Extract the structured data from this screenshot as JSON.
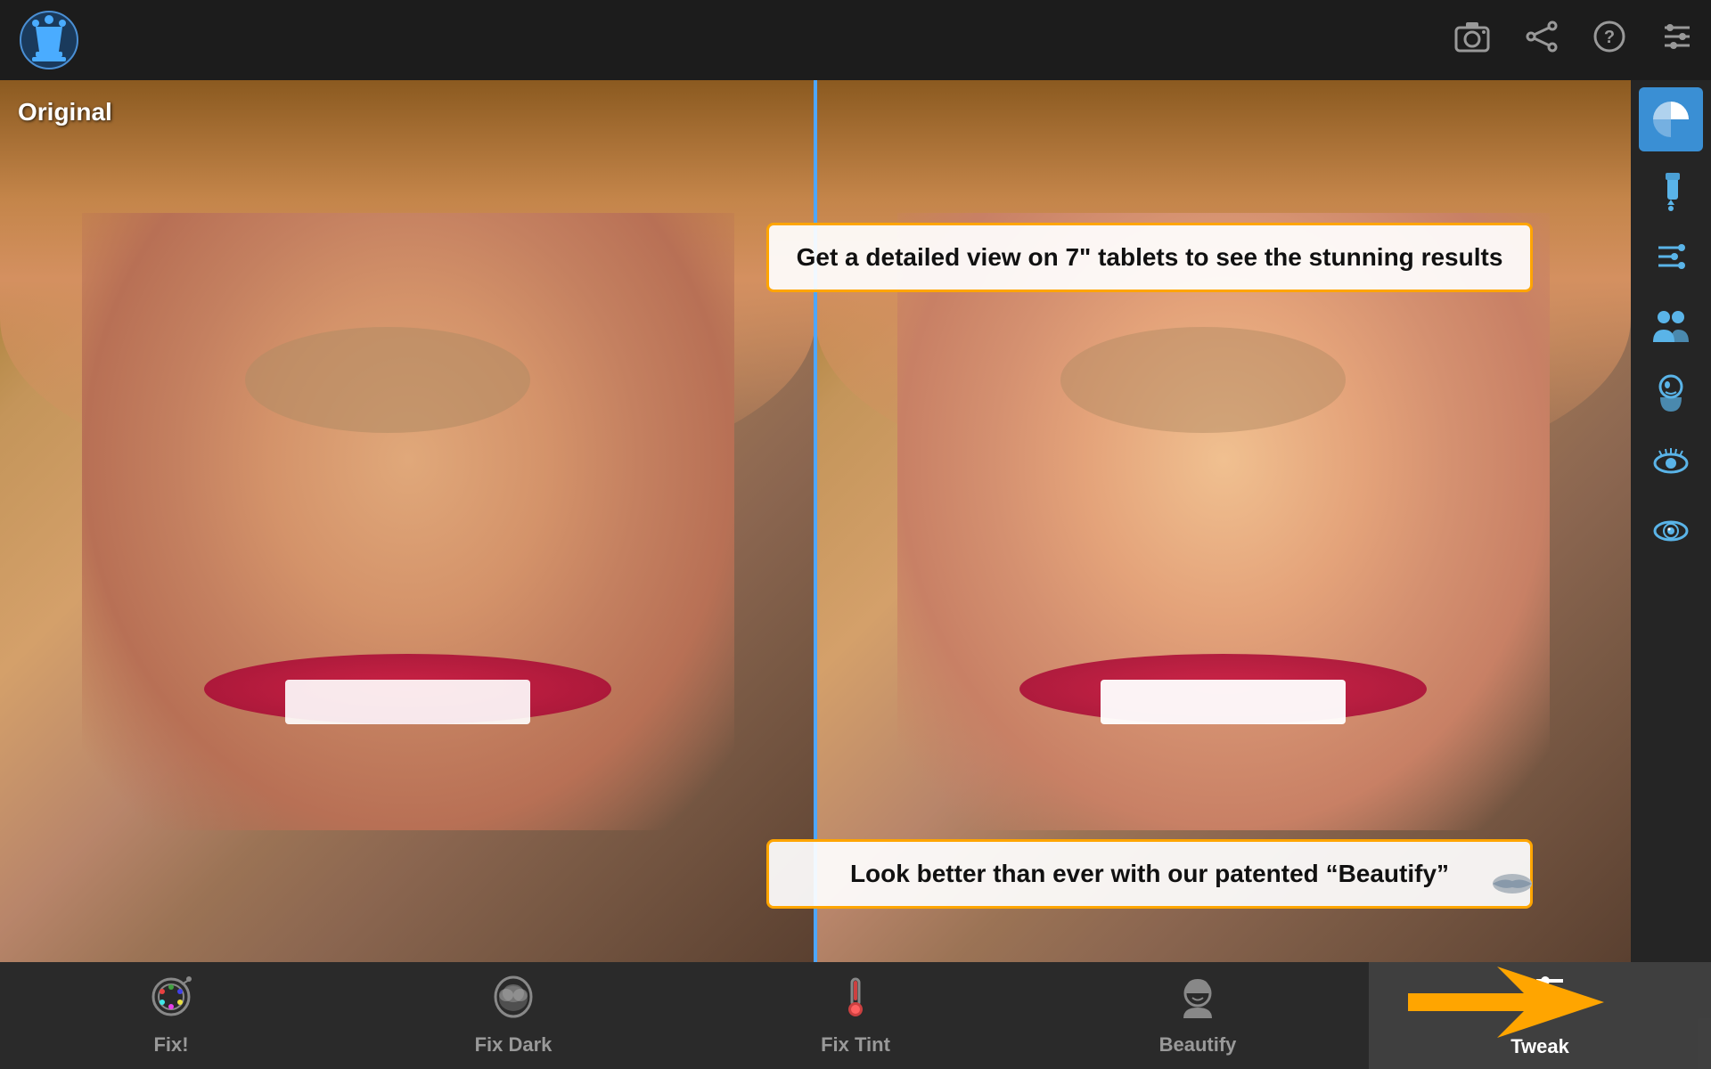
{
  "header": {
    "logo_alt": "Beauty App Logo",
    "camera_icon": "📷",
    "share_icon": "⬡",
    "help_icon": "?",
    "settings_icon": "⊟"
  },
  "image": {
    "original_label": "Original",
    "divider_description": "before-after divider"
  },
  "tooltips": [
    {
      "id": "tooltip-detail",
      "text": "Get a detailed view on 7\" tablets to see the stunning results"
    },
    {
      "id": "tooltip-beautify",
      "text": "Look better than ever with our patented “Beautify”"
    }
  ],
  "sidebar": {
    "icons": [
      {
        "name": "half-circle-icon",
        "symbol": "◐"
      },
      {
        "name": "dropper-icon",
        "symbol": "💉"
      },
      {
        "name": "thermometer-icon",
        "symbol": "🌡"
      },
      {
        "name": "group-icon",
        "symbol": "👥"
      },
      {
        "name": "face-icon",
        "symbol": "👤"
      },
      {
        "name": "eye-lashes-icon",
        "symbol": "👁"
      },
      {
        "name": "eye-color-icon",
        "symbol": "👁"
      }
    ]
  },
  "toolbar": {
    "items": [
      {
        "id": "fix",
        "label": "Fix!",
        "active": false
      },
      {
        "id": "fix-dark",
        "label": "Fix Dark",
        "active": false
      },
      {
        "id": "fix-tint",
        "label": "Fix Tint",
        "active": false
      },
      {
        "id": "beautify",
        "label": "Beautify",
        "active": false
      },
      {
        "id": "tweak",
        "label": "Tweak",
        "active": true
      }
    ]
  },
  "arrow": {
    "description": "pointing arrow",
    "color": "#FFA500"
  }
}
